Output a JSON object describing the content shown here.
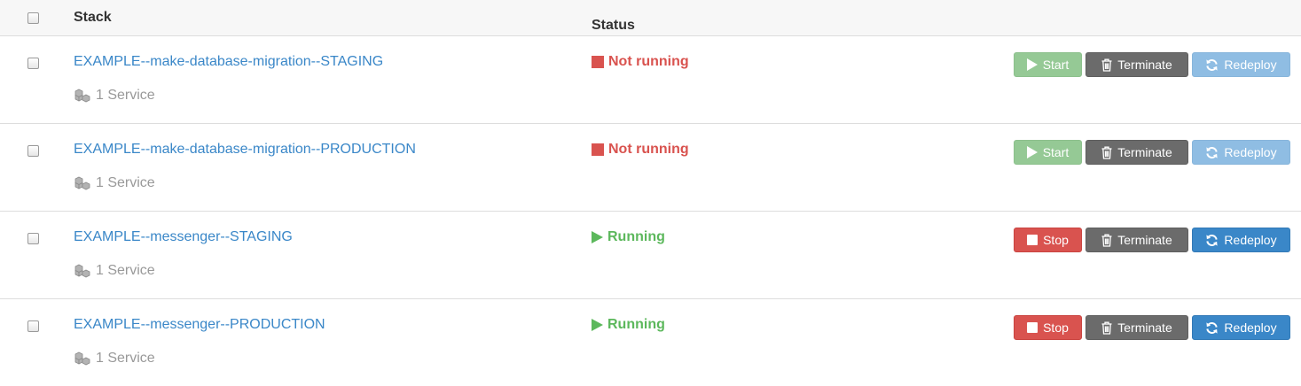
{
  "header": {
    "stack_label": "Stack",
    "status_label": "Status"
  },
  "colors": {
    "link": "#3a87c8",
    "stopped": "#d9534f",
    "running": "#5cb85c",
    "muted": "#999999"
  },
  "rows": [
    {
      "name": "EXAMPLE--make-database-migration--STAGING",
      "services": "1 Service",
      "status": "Not running",
      "state": "stopped",
      "primary_label": "Start",
      "terminate_label": "Terminate",
      "redeploy_label": "Redeploy"
    },
    {
      "name": "EXAMPLE--make-database-migration--PRODUCTION",
      "services": "1 Service",
      "status": "Not running",
      "state": "stopped",
      "primary_label": "Start",
      "terminate_label": "Terminate",
      "redeploy_label": "Redeploy"
    },
    {
      "name": "EXAMPLE--messenger--STAGING",
      "services": "1 Service",
      "status": "Running",
      "state": "running",
      "primary_label": "Stop",
      "terminate_label": "Terminate",
      "redeploy_label": "Redeploy"
    },
    {
      "name": "EXAMPLE--messenger--PRODUCTION",
      "services": "1 Service",
      "status": "Running",
      "state": "running",
      "primary_label": "Stop",
      "terminate_label": "Terminate",
      "redeploy_label": "Redeploy"
    }
  ],
  "icons": {
    "services": "cubes-icon",
    "start": "play-icon",
    "stop": "stop-icon",
    "terminate": "trash-icon",
    "redeploy": "refresh-icon",
    "not_running": "stopped-square-icon",
    "running": "running-play-icon"
  }
}
